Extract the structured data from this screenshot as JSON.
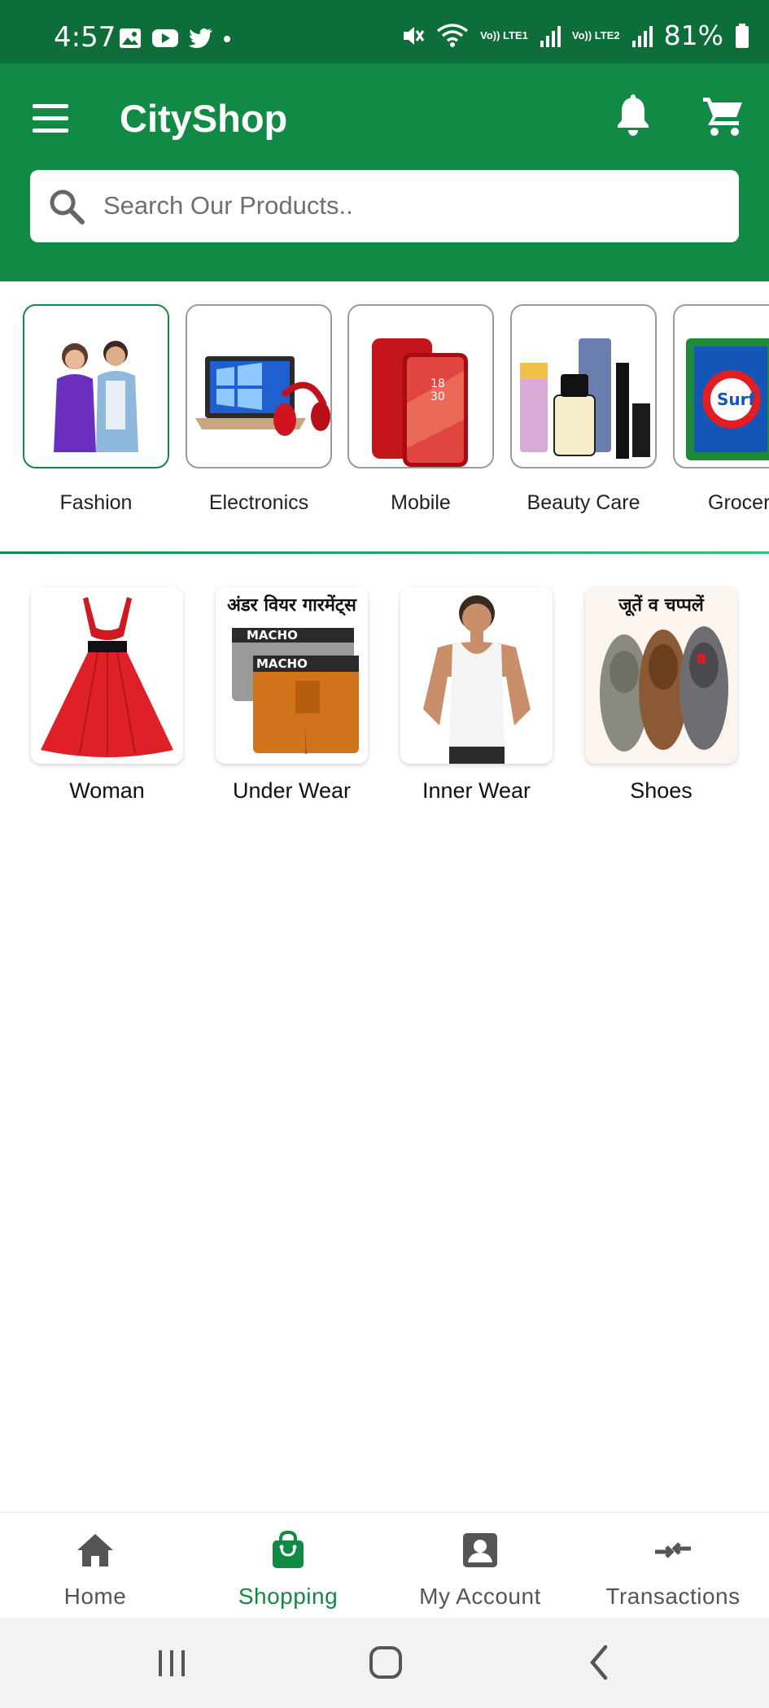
{
  "status_bar": {
    "time": "4:57",
    "battery": "81%",
    "network_1": "Vo)) LTE1",
    "network_2": "Vo)) LTE2",
    "left_icons": [
      "gallery-icon",
      "youtube-icon",
      "twitter-icon",
      "dot-icon"
    ],
    "right_icons": [
      "mute-icon",
      "wifi-icon",
      "signal-icon",
      "signal-icon",
      "battery-icon"
    ]
  },
  "app_bar": {
    "title": "CityShop",
    "icons": [
      "menu-icon",
      "bell-icon",
      "cart-icon"
    ]
  },
  "search": {
    "placeholder": "Search Our Products.."
  },
  "categories": [
    {
      "label": "Fashion",
      "active": true
    },
    {
      "label": "Electronics",
      "active": false
    },
    {
      "label": "Mobile",
      "active": false
    },
    {
      "label": "Beauty Care",
      "active": false
    },
    {
      "label": "Grocer",
      "active": false
    }
  ],
  "subcategories": [
    {
      "label": "Woman",
      "caption": ""
    },
    {
      "label": "Under Wear",
      "caption": "अंडर वियर गारमेंट्स"
    },
    {
      "label": "Inner Wear",
      "caption": ""
    },
    {
      "label": "Shoes",
      "caption": "जूतें व चप्पलें"
    }
  ],
  "underwear_brand": "MACHO",
  "bottom_nav": [
    {
      "label": "Home",
      "icon": "home-icon",
      "active": false
    },
    {
      "label": "Shopping",
      "icon": "shopping-bag-icon",
      "active": true
    },
    {
      "label": "My Account",
      "icon": "account-icon",
      "active": false
    },
    {
      "label": "Transactions",
      "icon": "transactions-icon",
      "active": false
    }
  ],
  "colors": {
    "status_bar": "#0d6e3a",
    "brand_green": "#118a45",
    "inactive_nav": "#555555"
  }
}
